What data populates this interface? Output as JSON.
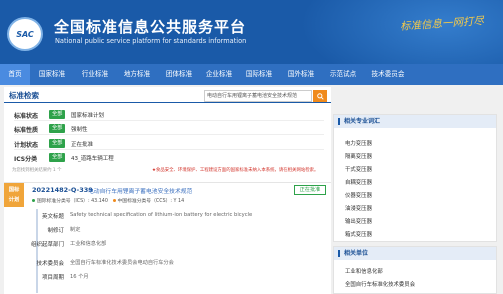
{
  "header": {
    "logo_text": "SAC",
    "title": "全国标准信息公共服务平台",
    "subtitle": "National public service platform  for standards information",
    "slogan": "标准信息一网打尽"
  },
  "nav": [
    "首页",
    "国家标准",
    "行业标准",
    "地方标准",
    "团体标准",
    "企业标准",
    "国际标准",
    "国外标准",
    "示范试点",
    "技术委员会"
  ],
  "search": {
    "tab_label": "标准检索",
    "query": "电动自行车用锂离子蓄电池安全技术规范"
  },
  "filters": [
    {
      "label": "标准状态",
      "tag": "全部",
      "value": "国家标准计划"
    },
    {
      "label": "标准性质",
      "tag": "全部",
      "value": "强制性"
    },
    {
      "label": "计划状态",
      "tag": "全部",
      "value": "正在批准"
    },
    {
      "label": "ICS分类",
      "tag": "全部",
      "value": "43_道路车辆工程"
    }
  ],
  "notice": "为您找到相关结果约 1 个",
  "notice_red": "★食品安全、环境保护、工程建设方面的国家标准未纳入本系统，请在相关网站检索。",
  "result": {
    "badge_line1": "国标",
    "badge_line2": "计划",
    "code": "20221482-Q-339",
    "title": "电动自行车用锂离子蓄电池安全技术规范",
    "status": "正在批准",
    "ics": "国际标准分类号（ICS）: 43.140",
    "ccs": "中国标准分类号（CCS）: Y 14",
    "details": [
      {
        "key": "英文标题",
        "value": "Safety technical specification of lithium-ion battery for electric bicycle"
      },
      {
        "key": "制修订",
        "value": "制定"
      },
      {
        "key": "组织起草部门",
        "value": "工业和信息化部"
      },
      {
        "key": "技术委员会",
        "value": "全国自行车标准化技术委员会电动自行车分会"
      },
      {
        "key": "项目周期",
        "value": "16 个月"
      }
    ]
  },
  "sidebar": {
    "card1_title": "相关专业词汇",
    "card1_items": [
      "电力变压器",
      "隔离变压器",
      "干式变压器",
      "自耦变压器",
      "仪器变压器",
      "油浸变压器",
      "输出变压器",
      "箱式变压器"
    ],
    "card2_title": "相关单位",
    "card2_items": [
      "工业和信息化部",
      "全国自行车标准化技术委员会"
    ]
  },
  "colors": {
    "brand_blue": "#1a5aa8",
    "nav_blue": "#2f6fc1",
    "tag_green": "#2ea24a",
    "accent_orange": "#f08a1c",
    "badge_orange": "#f0a53a",
    "notice_red": "#d2332a"
  }
}
